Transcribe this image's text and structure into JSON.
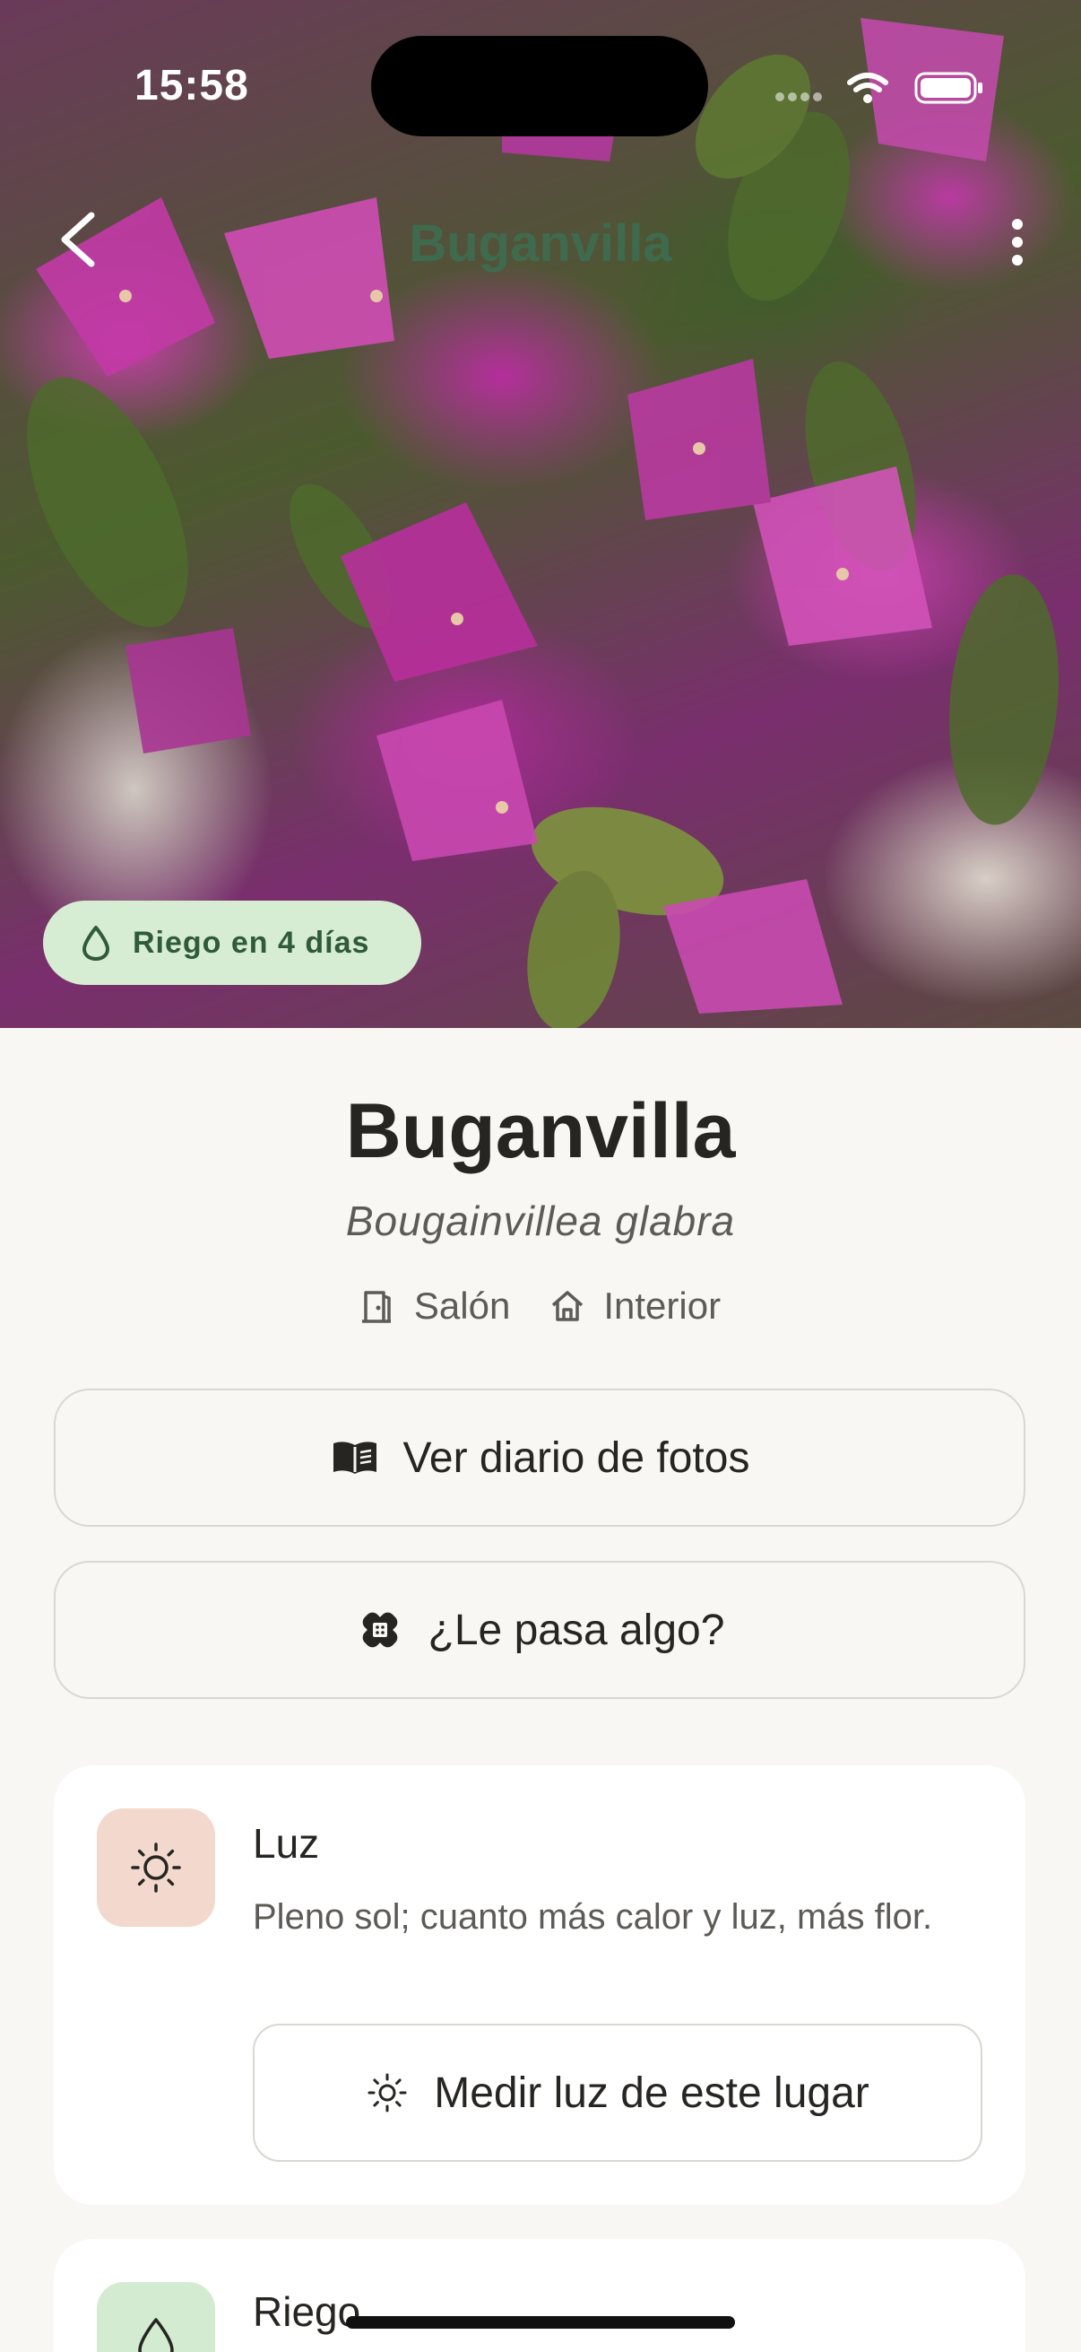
{
  "status_bar": {
    "time": "15:58"
  },
  "nav": {
    "title": "Buganvilla"
  },
  "hero": {
    "badge_text": "Riego en 4 días"
  },
  "plant": {
    "name": "Buganvilla",
    "scientific_name": "Bougainvillea glabra",
    "room": "Salón",
    "location": "Interior"
  },
  "actions": {
    "diary_label": "Ver diario de fotos",
    "issue_label": "¿Le pasa algo?"
  },
  "care": {
    "light": {
      "title": "Luz",
      "description": "Pleno sol; cuanto más calor y luz, más flor.",
      "measure_label": "Medir luz de este lugar",
      "icon": "sun-icon",
      "icon_bg": "#f3d9cd"
    },
    "water": {
      "title": "Riego",
      "icon": "droplet-icon",
      "icon_bg": "#d3ecd1"
    }
  },
  "colors": {
    "accent_green": "#3f6a4e",
    "badge_bg": "#d7edd3",
    "page_bg": "#f8f7f3"
  }
}
